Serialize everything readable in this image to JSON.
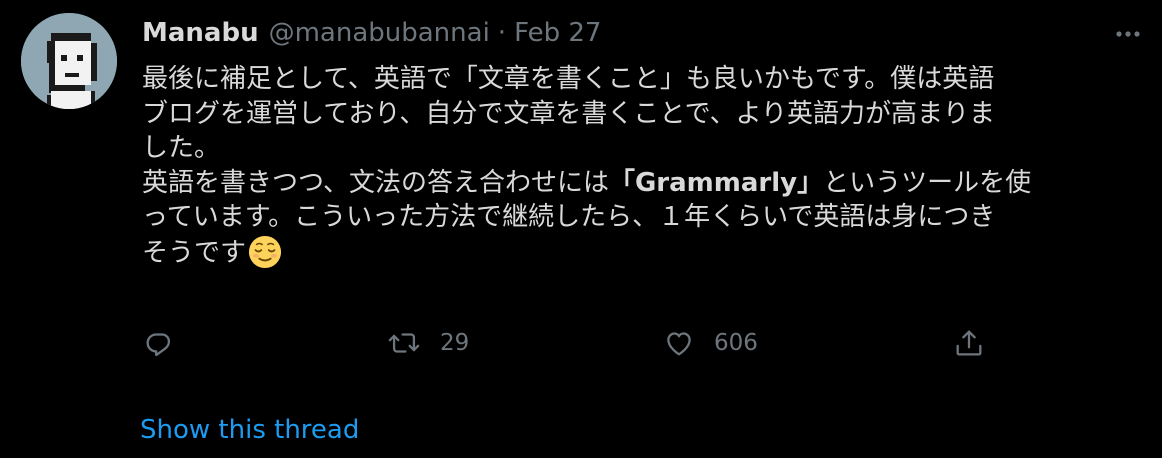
{
  "author": {
    "name": "Manabu",
    "handle": "@manabubannai",
    "separator": "·",
    "date": "Feb 27"
  },
  "tweet": {
    "line1": "最後に補足として、英語で「文章を書くこと」も良いかもです。僕は英語",
    "line2": "ブログを運営しており、自分で文章を書くことで、より英語力が高まりま",
    "line3": "した。",
    "line4_pre": "英語を書きつつ、文法の答え合わせには",
    "line4_bold": "「Grammarly」",
    "line4_post": "というツールを使",
    "line5": "っています。こういった方法で継続したら、１年くらいで英語は身につき",
    "line6": "そうです",
    "emoji": "relieved-face"
  },
  "actions": {
    "retweet_count": "29",
    "like_count": "606"
  },
  "thread_link": "Show this thread",
  "colors": {
    "background": "#000000",
    "text": "#d9d9d9",
    "muted": "#6e767d",
    "link": "#1d9bf0"
  }
}
